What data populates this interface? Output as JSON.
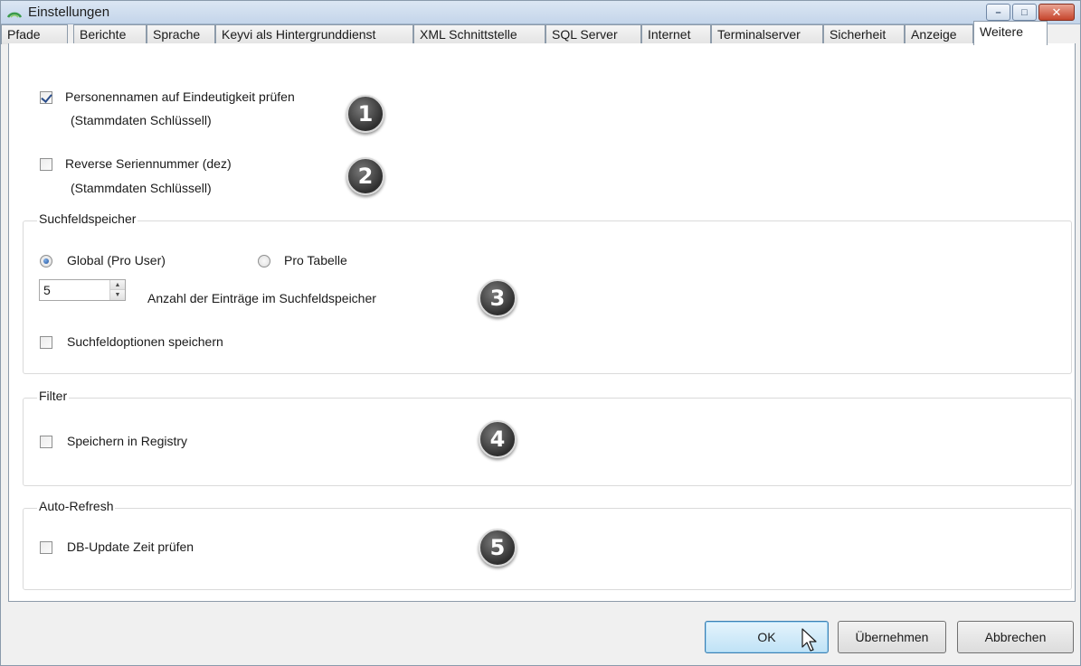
{
  "window": {
    "title": "Einstellungen",
    "controls": {
      "minimize_icon": "minimize-icon",
      "maximize_icon": "maximize-icon",
      "close_icon": "close-icon"
    }
  },
  "tabs": [
    {
      "label": "Pfade"
    },
    {
      "label": "Berichte"
    },
    {
      "label": "Sprache"
    },
    {
      "label": "Keyvi als Hintergrunddienst"
    },
    {
      "label": "XML Schnittstelle"
    },
    {
      "label": "SQL Server"
    },
    {
      "label": "Internet"
    },
    {
      "label": "Terminalserver"
    },
    {
      "label": "Sicherheit"
    },
    {
      "label": "Anzeige"
    },
    {
      "label": "Weitere"
    }
  ],
  "active_tab": "Weitere",
  "options": {
    "personennamen": {
      "label": "Personennamen auf Eindeutigkeit prüfen",
      "sublabel": "(Stammdaten Schlüssell)",
      "checked": true
    },
    "reverse": {
      "label": "Reverse Seriennummer (dez)",
      "sublabel": "(Stammdaten Schlüssell)",
      "checked": false
    }
  },
  "suchfeldspeicher": {
    "title": "Suchfeldspeicher",
    "radio_global": {
      "label": "Global (Pro User)",
      "checked": true
    },
    "radio_tabelle": {
      "label": "Pro Tabelle",
      "checked": false
    },
    "entries_value": "5",
    "entries_label": "Anzahl der Einträge im Suchfeldspeicher",
    "save_options": {
      "label": "Suchfeldoptionen speichern",
      "checked": false
    }
  },
  "filter": {
    "title": "Filter",
    "registry": {
      "label": "Speichern in Registry",
      "checked": false
    }
  },
  "autorefresh": {
    "title": "Auto-Refresh",
    "db_update": {
      "label": "DB-Update Zeit prüfen",
      "checked": false
    }
  },
  "badges": [
    "1",
    "2",
    "3",
    "4",
    "5"
  ],
  "buttons": {
    "ok": "OK",
    "apply": "Übernehmen",
    "cancel": "Abbrechen"
  },
  "colors": {
    "titlebar": "#c4d5ea",
    "close_button": "#c6452c",
    "default_button": "#bfe2f6"
  }
}
